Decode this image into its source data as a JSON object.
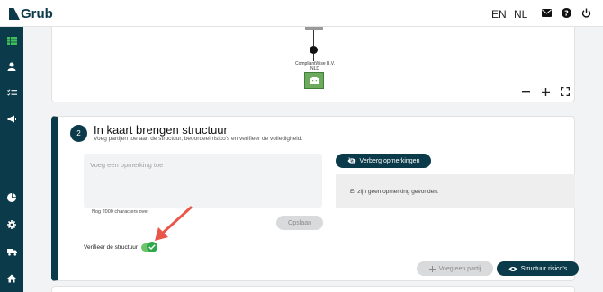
{
  "app": {
    "logo_text": "Grub"
  },
  "header": {
    "languages": [
      "EN",
      "NL"
    ],
    "active_language": "NL",
    "icons": [
      "mail-icon",
      "help-icon",
      "power-icon"
    ]
  },
  "sidebar": {
    "items": [
      {
        "icon": "table-icon",
        "active": true
      },
      {
        "icon": "user-icon",
        "active": false
      },
      {
        "icon": "checklist-icon",
        "active": false
      },
      {
        "icon": "megaphone-icon",
        "active": false
      },
      {
        "icon": "pie-chart-icon",
        "active": false
      },
      {
        "icon": "gear-icon",
        "active": false
      },
      {
        "icon": "delivery-truck-icon",
        "active": false
      },
      {
        "icon": "home-icon",
        "active": false
      }
    ]
  },
  "structure_preview": {
    "node_label": "CompliantWise B.V.",
    "node_sublabel": "NLD"
  },
  "step": {
    "number": "2",
    "title": "In kaart brengen structuur",
    "subtitle": "Voeg partijen toe aan de structuur, beoordeel risico's en verifieer de volledigheid.",
    "remark_placeholder": "Voeg een opmerking toe",
    "char_count": "Nog 2000 characters over",
    "save_label": "Opslaan",
    "hide_remarks_label": "Verberg opmerkingen",
    "no_remarks_text": "Er zijn geen opmerking gevonden.",
    "verify_label": "Verifieer de structuur",
    "verify_checked": true,
    "add_party_label": "Voeg een partij",
    "risk_structure_label": "Structuur risico's"
  },
  "colors": {
    "brand": "#0b3b4a",
    "node_green": "#6cab5e",
    "toggle_green": "#2fa84a",
    "arrow": "#e8574a"
  }
}
